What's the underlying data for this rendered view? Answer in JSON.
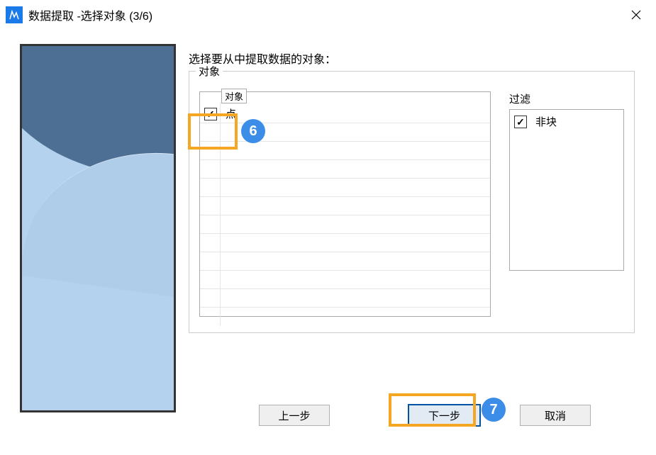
{
  "titlebar": {
    "title": "数据提取 -选择对象 (3/6)"
  },
  "instruction": "选择要从中提取数据的对象：",
  "object_group": {
    "label": "对象",
    "table_header": "对象",
    "rows": [
      {
        "checked": true,
        "label": "点"
      }
    ]
  },
  "filter_group": {
    "label": "过滤",
    "rows": [
      {
        "checked": true,
        "label": "非块"
      }
    ]
  },
  "buttons": {
    "prev": "上一步",
    "next": "下一步",
    "cancel": "取消"
  },
  "badges": {
    "six": "6",
    "seven": "7"
  }
}
